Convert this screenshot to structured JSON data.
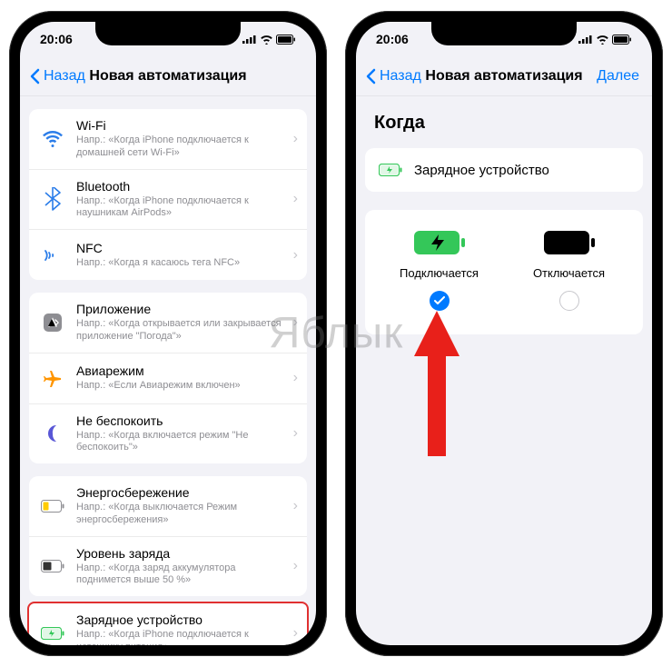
{
  "status": {
    "time": "20:06"
  },
  "left": {
    "nav": {
      "back": "Назад",
      "title": "Новая автоматизация"
    },
    "g1": [
      {
        "title": "Wi-Fi",
        "sub": "Напр.: «Когда iPhone подключается к домашней сети Wi-Fi»"
      },
      {
        "title": "Bluetooth",
        "sub": "Напр.: «Когда iPhone подключается к наушникам AirPods»"
      },
      {
        "title": "NFC",
        "sub": "Напр.: «Когда я касаюсь тега NFC»"
      }
    ],
    "g2": [
      {
        "title": "Приложение",
        "sub": "Напр.: «Когда открывается или закрывается приложение \"Погода\"»"
      },
      {
        "title": "Авиарежим",
        "sub": "Напр.: «Если Авиарежим включен»"
      },
      {
        "title": "Не беспокоить",
        "sub": "Напр.: «Когда включается режим \"Не беспокоить\"»"
      }
    ],
    "g3": [
      {
        "title": "Энергосбережение",
        "sub": "Напр.: «Когда выключается Режим энергосбережения»"
      },
      {
        "title": "Уровень заряда",
        "sub": "Напр.: «Когда заряд аккумулятора поднимется выше 50 %»"
      },
      {
        "title": "Зарядное устройство",
        "sub": "Напр.: «Когда iPhone подключается к источнику питания»"
      }
    ]
  },
  "right": {
    "nav": {
      "back": "Назад",
      "title": "Новая автоматизация",
      "next": "Далее"
    },
    "section": "Когда",
    "trigger": "Зарядное устройство",
    "opt_connect": "Подключается",
    "opt_disconnect": "Отключается"
  },
  "watermark": "Яблык"
}
